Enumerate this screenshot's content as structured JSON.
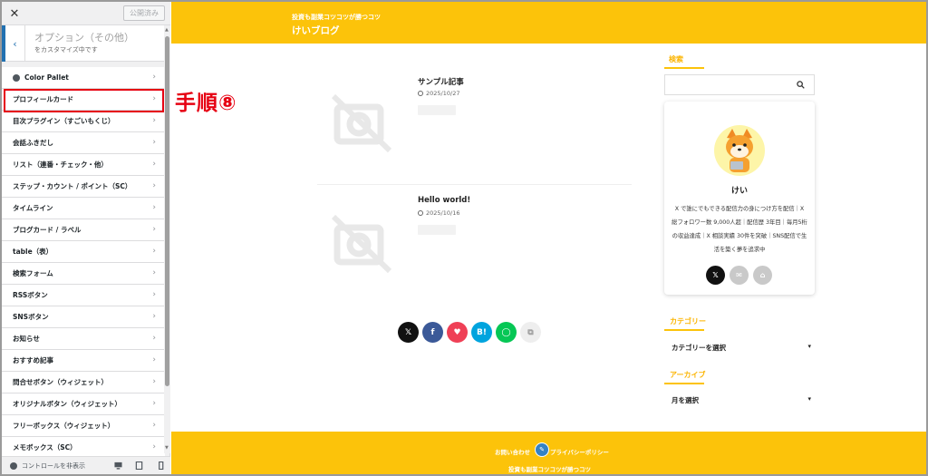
{
  "customizer": {
    "close_label": "✕",
    "published_label": "公開済み",
    "back_label": "‹",
    "section_title": "オプション（その他）",
    "section_sub": "をカスタマイズ中です",
    "menu_items": [
      {
        "label": "Color Pallet"
      },
      {
        "label": "プロフィールカード"
      },
      {
        "label": "目次プラグイン（すごいもくじ）"
      },
      {
        "label": "会話ふきだし"
      },
      {
        "label": "リスト（連番・チェック・他）"
      },
      {
        "label": "ステップ・カウント / ポイント（SC）"
      },
      {
        "label": "タイムライン"
      },
      {
        "label": "ブログカード / ラベル"
      },
      {
        "label": "table（表）"
      },
      {
        "label": "検索フォーム"
      },
      {
        "label": "RSSボタン"
      },
      {
        "label": "SNSボタン"
      },
      {
        "label": "お知らせ"
      },
      {
        "label": "おすすめ記事"
      },
      {
        "label": "問合せボタン（ウィジェット）"
      },
      {
        "label": "オリジナルボタン（ウィジェット）"
      },
      {
        "label": "フリーボックス（ウィジェット）"
      },
      {
        "label": "メモボックス（SC）"
      }
    ],
    "chevron": "›",
    "hide_controls_label": "コントロールを非表示",
    "highlighted_item": "プロフィールカード"
  },
  "annotation": "手順⑧",
  "site": {
    "tagline": "投資も副業コツコツが勝つコツ",
    "title": "けいブログ",
    "posts": [
      {
        "title": "サンプル記事",
        "date": "2025/10/27"
      },
      {
        "title": "Hello world!",
        "date": "2025/10/16"
      }
    ],
    "share_buttons": [
      {
        "name": "x",
        "glyph": "𝕏",
        "color": "#111111"
      },
      {
        "name": "facebook",
        "glyph": "f",
        "color": "#3b5998"
      },
      {
        "name": "pocket",
        "glyph": "♥",
        "color": "#ef4056"
      },
      {
        "name": "hatena",
        "glyph": "B!",
        "color": "#00a4de"
      },
      {
        "name": "line",
        "glyph": "◯",
        "color": "#06c755"
      },
      {
        "name": "copy",
        "glyph": "⧉",
        "color": "#eeeeee"
      }
    ],
    "widgets": {
      "search_title": "検索",
      "profile": {
        "name": "けい",
        "description": "X で誰にでもできる配信力の身につけ方を配信｜X 総フォロワー数 9,000人超｜配信歴 3年目｜毎月5桁の収益達成｜X 相談実績 30件を突破｜SNS配信で生活を築く夢を追求中"
      },
      "category_title": "カテゴリー",
      "category_select": "カテゴリーを選択",
      "archive_title": "アーカイブ",
      "archive_select": "月を選択"
    },
    "footer": {
      "contact": "お問い合わせ",
      "privacy": "プライバシーポリシー",
      "copy": "投資も副業コツコツが勝つコツ"
    }
  },
  "colors": {
    "brand_yellow": "#fcc30a",
    "annotation_red": "#e60012",
    "wp_blue": "#2271b1"
  }
}
